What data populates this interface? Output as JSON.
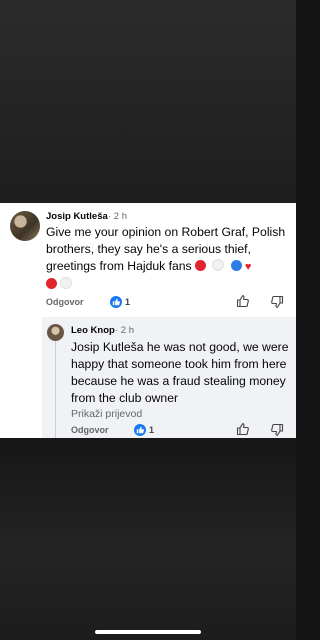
{
  "comment": {
    "author": "Josip Kutleša",
    "time": "· 2 h",
    "text": "Give me your opinion on Robert Graf, Polish brothers, they say he's a serious thief, greetings from Hajduk fans",
    "emojis": [
      "red-circle",
      "white-circle",
      "blue-circle",
      "red-heart",
      "red-circle",
      "white-circle"
    ],
    "reply_label": "Odgovor",
    "like_count": "1"
  },
  "reply": {
    "author": "Leo Knop",
    "time": "· 2 h",
    "text": "Josip Kutleša he was not good, we were happy that someone took him from here because he was a fraud stealing money from the club owner",
    "translate_label": "Prikaži prijevod",
    "reply_label": "Odgovor",
    "like_count": "1"
  },
  "colors": {
    "like_blue": "#1877f2",
    "secondary_text": "#65676b",
    "reply_background": "#f0f2f5"
  }
}
